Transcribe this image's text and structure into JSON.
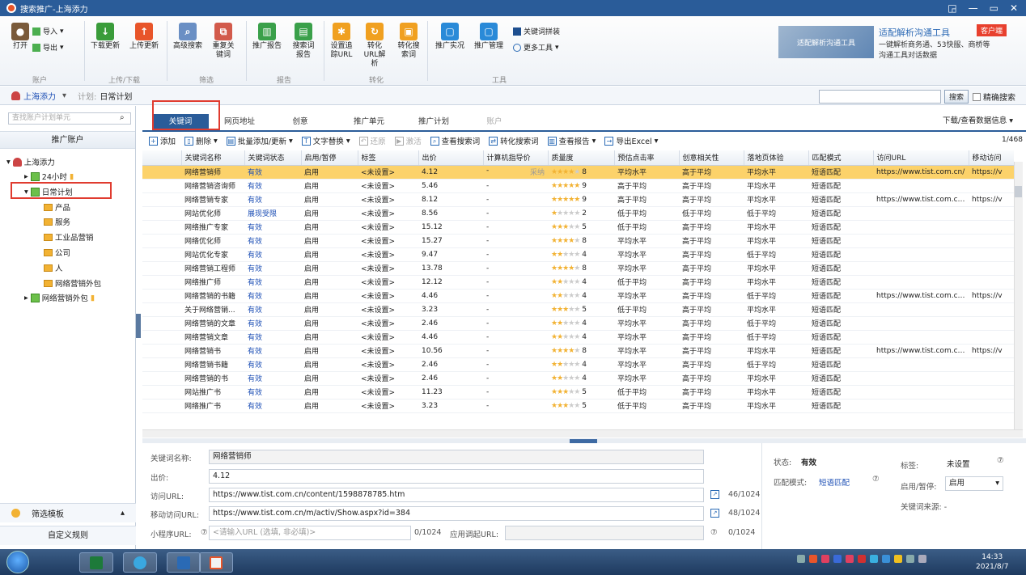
{
  "window": {
    "title": "搜索推广-上海添力"
  },
  "ribbon": {
    "groups": [
      {
        "name": "账户",
        "buttons": [
          "打开"
        ],
        "small": [
          "导入",
          "导出"
        ]
      },
      {
        "name": "上传/下载",
        "buttons": [
          "下载更新",
          "上传更新"
        ]
      },
      {
        "name": "筛选",
        "buttons": [
          "高级搜索",
          "重复关键词"
        ]
      },
      {
        "name": "报告",
        "buttons": [
          "推广报告",
          "搜索词报告"
        ]
      },
      {
        "name": "转化",
        "buttons": [
          "设置追踪URL",
          "转化URL解析",
          "转化搜索词"
        ]
      },
      {
        "name": "工具",
        "buttons": [
          "推广实况",
          "推广管理"
        ],
        "small": [
          "关键词拼装",
          "更多工具"
        ]
      }
    ],
    "ad": {
      "img_text": "适配解析沟通工具",
      "title": "适配解析沟通工具",
      "desc": "一键解析商务通、53快服、商桥等沟通工具对话数据",
      "tag": "客户端"
    }
  },
  "accountbar": {
    "account": "上海添力",
    "plan_label": "计划:",
    "plan": "日常计划",
    "search_btn": "搜索",
    "exact_label": "精确搜索"
  },
  "sidebar": {
    "search_placeholder": "查找账户计划单元",
    "header": "推广账户",
    "tree": [
      "上海添力",
      "24小时",
      "日常计划",
      "产品",
      "服务",
      "工业品营销",
      "公司",
      "人",
      "网络营销外包",
      "网络营销外包"
    ],
    "bottom1": "筛选模板",
    "bottom2": "自定义规则"
  },
  "tabs": [
    "关键词",
    "网页地址",
    "创意",
    "推广单元",
    "推广计划",
    "账户"
  ],
  "dlinfo": "下载/查看数据信息",
  "toolbar": {
    "add": "添加",
    "delete": "删除",
    "batch": "批量添加/更新",
    "text": "文字替换",
    "restore": "还原",
    "activate": "激活",
    "view_search": "查看搜索词",
    "conv_search": "转化搜索词",
    "view_report": "查看报告",
    "export": "导出Excel",
    "page": "1/468"
  },
  "grid": {
    "columns": [
      "关键词名称",
      "关键词状态",
      "启用/暂停",
      "标签",
      "出价",
      "计算机指导价",
      "质量度",
      "预估点击率",
      "创意相关性",
      "落地页体验",
      "匹配模式",
      "访问URL",
      "移动访问"
    ],
    "rows": [
      {
        "kw": "网络营销师",
        "st": "有效",
        "en": "启用",
        "tag": "<未设置>",
        "bid": "4.12",
        "guide": "-",
        "q": 8,
        "ctr": "平均水平",
        "rel": "高于平均",
        "lp": "平均水平",
        "match": "短语匹配",
        "url": "https://www.tist.com.cn/",
        "murl": "https://v",
        "sel": true
      },
      {
        "kw": "网络营销咨询师",
        "st": "有效",
        "en": "启用",
        "tag": "<未设置>",
        "bid": "5.46",
        "guide": "-",
        "q": 9,
        "ctr": "高于平均",
        "rel": "高于平均",
        "lp": "平均水平",
        "match": "短语匹配",
        "url": "",
        "murl": ""
      },
      {
        "kw": "网络营销专家",
        "st": "有效",
        "en": "启用",
        "tag": "<未设置>",
        "bid": "8.12",
        "guide": "-",
        "q": 9,
        "ctr": "高于平均",
        "rel": "高于平均",
        "lp": "平均水平",
        "match": "短语匹配",
        "url": "https://www.tist.com.cn...",
        "murl": "https://v"
      },
      {
        "kw": "网站优化师",
        "st": "展现受限",
        "en": "启用",
        "tag": "<未设置>",
        "bid": "8.56",
        "guide": "-",
        "q": 2,
        "ctr": "低于平均",
        "rel": "低于平均",
        "lp": "低于平均",
        "match": "短语匹配",
        "url": "",
        "murl": ""
      },
      {
        "kw": "网络推广专家",
        "st": "有效",
        "en": "启用",
        "tag": "<未设置>",
        "bid": "15.12",
        "guide": "-",
        "q": 5,
        "ctr": "低于平均",
        "rel": "高于平均",
        "lp": "平均水平",
        "match": "短语匹配",
        "url": "",
        "murl": ""
      },
      {
        "kw": "网络优化师",
        "st": "有效",
        "en": "启用",
        "tag": "<未设置>",
        "bid": "15.27",
        "guide": "-",
        "q": 8,
        "ctr": "平均水平",
        "rel": "高于平均",
        "lp": "平均水平",
        "match": "短语匹配",
        "url": "",
        "murl": ""
      },
      {
        "kw": "网站优化专家",
        "st": "有效",
        "en": "启用",
        "tag": "<未设置>",
        "bid": "9.47",
        "guide": "-",
        "q": 4,
        "ctr": "平均水平",
        "rel": "高于平均",
        "lp": "低于平均",
        "match": "短语匹配",
        "url": "",
        "murl": ""
      },
      {
        "kw": "网络营销工程师",
        "st": "有效",
        "en": "启用",
        "tag": "<未设置>",
        "bid": "13.78",
        "guide": "-",
        "q": 8,
        "ctr": "平均水平",
        "rel": "高于平均",
        "lp": "平均水平",
        "match": "短语匹配",
        "url": "",
        "murl": ""
      },
      {
        "kw": "网络推广师",
        "st": "有效",
        "en": "启用",
        "tag": "<未设置>",
        "bid": "12.12",
        "guide": "-",
        "q": 4,
        "ctr": "低于平均",
        "rel": "高于平均",
        "lp": "平均水平",
        "match": "短语匹配",
        "url": "",
        "murl": ""
      },
      {
        "kw": "网络营销的书籍",
        "st": "有效",
        "en": "启用",
        "tag": "<未设置>",
        "bid": "4.46",
        "guide": "-",
        "q": 4,
        "ctr": "平均水平",
        "rel": "高于平均",
        "lp": "低于平均",
        "match": "短语匹配",
        "url": "https://www.tist.com.cn...",
        "murl": "https://v"
      },
      {
        "kw": "关于网络营销...",
        "st": "有效",
        "en": "启用",
        "tag": "<未设置>",
        "bid": "3.23",
        "guide": "-",
        "q": 5,
        "ctr": "低于平均",
        "rel": "高于平均",
        "lp": "平均水平",
        "match": "短语匹配",
        "url": "",
        "murl": ""
      },
      {
        "kw": "网络营销的文章",
        "st": "有效",
        "en": "启用",
        "tag": "<未设置>",
        "bid": "2.46",
        "guide": "-",
        "q": 4,
        "ctr": "平均水平",
        "rel": "高于平均",
        "lp": "低于平均",
        "match": "短语匹配",
        "url": "",
        "murl": ""
      },
      {
        "kw": "网络营销文章",
        "st": "有效",
        "en": "启用",
        "tag": "<未设置>",
        "bid": "4.46",
        "guide": "-",
        "q": 4,
        "ctr": "平均水平",
        "rel": "高于平均",
        "lp": "低于平均",
        "match": "短语匹配",
        "url": "",
        "murl": ""
      },
      {
        "kw": "网络营销书",
        "st": "有效",
        "en": "启用",
        "tag": "<未设置>",
        "bid": "10.56",
        "guide": "-",
        "q": 8,
        "ctr": "平均水平",
        "rel": "高于平均",
        "lp": "平均水平",
        "match": "短语匹配",
        "url": "https://www.tist.com.cn...",
        "murl": "https://v"
      },
      {
        "kw": "网络营销书籍",
        "st": "有效",
        "en": "启用",
        "tag": "<未设置>",
        "bid": "2.46",
        "guide": "-",
        "q": 4,
        "ctr": "平均水平",
        "rel": "高于平均",
        "lp": "低于平均",
        "match": "短语匹配",
        "url": "",
        "murl": ""
      },
      {
        "kw": "网络营销的书",
        "st": "有效",
        "en": "启用",
        "tag": "<未设置>",
        "bid": "2.46",
        "guide": "-",
        "q": 4,
        "ctr": "平均水平",
        "rel": "高于平均",
        "lp": "平均水平",
        "match": "短语匹配",
        "url": "",
        "murl": ""
      },
      {
        "kw": "网站推广书",
        "st": "有效",
        "en": "启用",
        "tag": "<未设置>",
        "bid": "11.23",
        "guide": "-",
        "q": 5,
        "ctr": "低于平均",
        "rel": "高于平均",
        "lp": "平均水平",
        "match": "短语匹配",
        "url": "",
        "murl": ""
      },
      {
        "kw": "网络推广书",
        "st": "有效",
        "en": "启用",
        "tag": "<未设置>",
        "bid": "3.23",
        "guide": "-",
        "q": 5,
        "ctr": "低于平均",
        "rel": "高于平均",
        "lp": "平均水平",
        "match": "短语匹配",
        "url": "",
        "murl": ""
      }
    ],
    "guide_note": "采纳"
  },
  "detail": {
    "kw_label": "关键词名称:",
    "kw_value": "网络营销师",
    "bid_label": "出价:",
    "bid_value": "4.12",
    "url_label": "访问URL:",
    "url_value": "https://www.tist.com.cn/content/1598878785.htm",
    "url_count": "46/1024",
    "murl_label": "移动访问URL:",
    "murl_value": "https://www.tist.com.cn/m/activ/Show.aspx?id=384",
    "murl_count": "48/1024",
    "mini_label": "小程序URL:",
    "mini_placeholder": "<请输入URL (选填, 非必填)>",
    "mini_count": "0/1024",
    "app_label": "应用调起URL:",
    "app_count": "0/1024",
    "status_label": "状态:",
    "status_value": "有效",
    "match_label": "匹配模式:",
    "match_value": "短语匹配",
    "tag_label": "标签:",
    "tag_value": "未设置",
    "enable_label": "启用/暂停:",
    "enable_value": "启用",
    "source_label": "关键词来源: -"
  },
  "taskbar": {
    "time": "14:33",
    "date": "2021/8/7"
  }
}
